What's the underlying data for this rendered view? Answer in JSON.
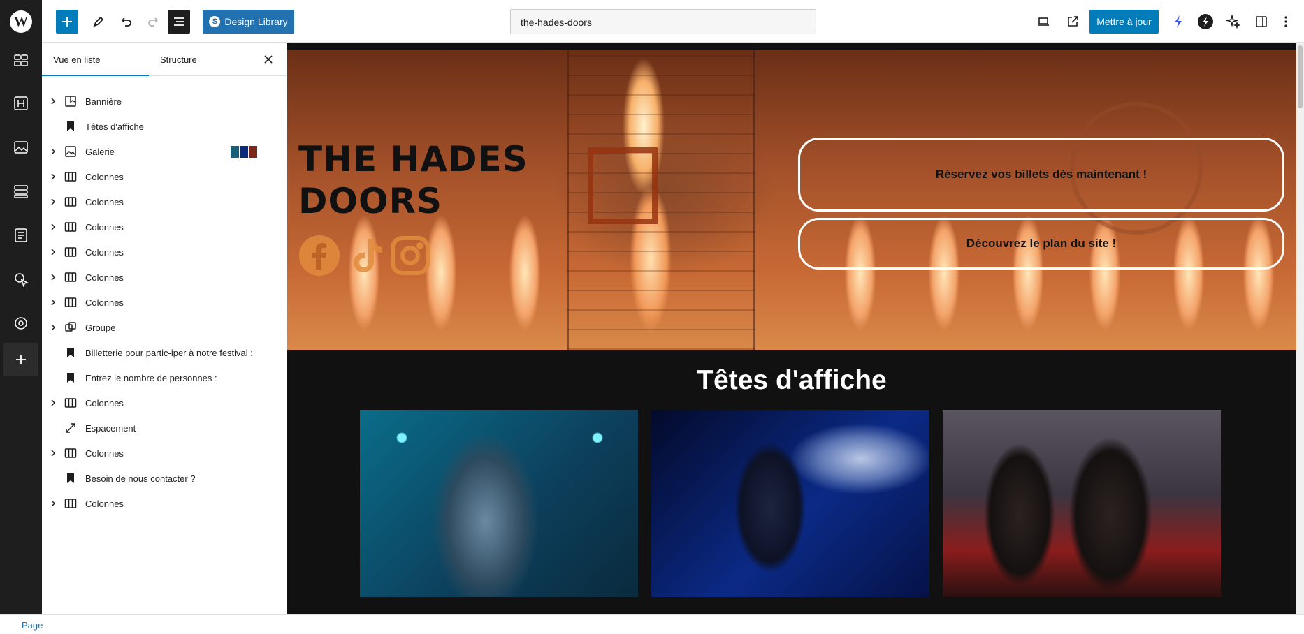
{
  "toolbar": {
    "design_library_label": "Design Library",
    "url_slug": "the-hades-doors",
    "update_label": "Mettre à jour"
  },
  "listview": {
    "tabs": [
      "Vue en liste",
      "Structure"
    ],
    "items": [
      {
        "label": "Bannière",
        "icon": "cover-icon",
        "expandable": true
      },
      {
        "label": "Têtes d'affiche",
        "icon": "heading-icon",
        "expandable": false
      },
      {
        "label": "Galerie",
        "icon": "gallery-icon",
        "expandable": true
      },
      {
        "label": "Colonnes",
        "icon": "columns-icon",
        "expandable": true
      },
      {
        "label": "Colonnes",
        "icon": "columns-icon",
        "expandable": true
      },
      {
        "label": "Colonnes",
        "icon": "columns-icon",
        "expandable": true
      },
      {
        "label": "Colonnes",
        "icon": "columns-icon",
        "expandable": true
      },
      {
        "label": "Colonnes",
        "icon": "columns-icon",
        "expandable": true
      },
      {
        "label": "Colonnes",
        "icon": "columns-icon",
        "expandable": true
      },
      {
        "label": "Groupe",
        "icon": "group-icon",
        "expandable": true
      },
      {
        "label": "Billetterie pour partic-iper à notre festival :",
        "icon": "heading-icon",
        "expandable": false
      },
      {
        "label": "Entrez le nombre de personnes :",
        "icon": "heading-icon",
        "expandable": false
      },
      {
        "label": "Colonnes",
        "icon": "columns-icon",
        "expandable": true
      },
      {
        "label": "Espacement",
        "icon": "spacer-icon",
        "expandable": false
      },
      {
        "label": "Colonnes",
        "icon": "columns-icon",
        "expandable": true
      },
      {
        "label": "Besoin de nous contacter ?",
        "icon": "heading-icon",
        "expandable": false
      },
      {
        "label": "Colonnes",
        "icon": "columns-icon",
        "expandable": true
      }
    ]
  },
  "hero": {
    "title_line1": "THE HADES",
    "title_line2": "DOORS",
    "button1": "Réservez vos billets dès maintenant !",
    "button2": "Découvrez le plan du site !"
  },
  "section": {
    "title": "Têtes d'affiche"
  },
  "footer": {
    "breadcrumb": "Page"
  },
  "colors": {
    "accent": "#007cba",
    "sidebar_bg": "#1e1e1e",
    "hero_social": "#e08b3d"
  }
}
